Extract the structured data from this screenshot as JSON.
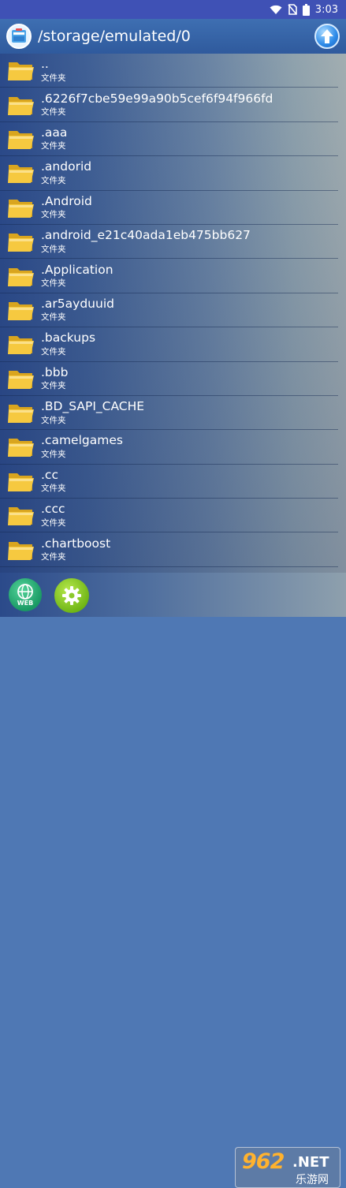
{
  "status": {
    "time": "3:03"
  },
  "header": {
    "path": "/storage/emulated/0"
  },
  "files": [
    {
      "name": "..",
      "type": "文件夹"
    },
    {
      "name": ".6226f7cbe59e99a90b5cef6f94f966fd",
      "type": "文件夹"
    },
    {
      "name": ".aaa",
      "type": "文件夹"
    },
    {
      "name": ".andorid",
      "type": "文件夹"
    },
    {
      "name": ".Android",
      "type": "文件夹"
    },
    {
      "name": ".android_e21c40ada1eb475bb627",
      "type": "文件夹"
    },
    {
      "name": ".Application",
      "type": "文件夹"
    },
    {
      "name": ".ar5ayduuid",
      "type": "文件夹"
    },
    {
      "name": ".backups",
      "type": "文件夹"
    },
    {
      "name": ".bbb",
      "type": "文件夹"
    },
    {
      "name": ".BD_SAPI_CACHE",
      "type": "文件夹"
    },
    {
      "name": ".camelgames",
      "type": "文件夹"
    },
    {
      "name": ".cc",
      "type": "文件夹"
    },
    {
      "name": ".ccc",
      "type": "文件夹"
    },
    {
      "name": ".chartboost",
      "type": "文件夹"
    }
  ],
  "bottom": {
    "web_label": "WEB"
  },
  "watermark": {
    "brand": "962",
    "net": ".NET",
    "cn": "乐游网"
  },
  "colors": {
    "status_bar": "#3f51b5",
    "folder": "#f6c940",
    "accent": "#2c8ae8"
  }
}
